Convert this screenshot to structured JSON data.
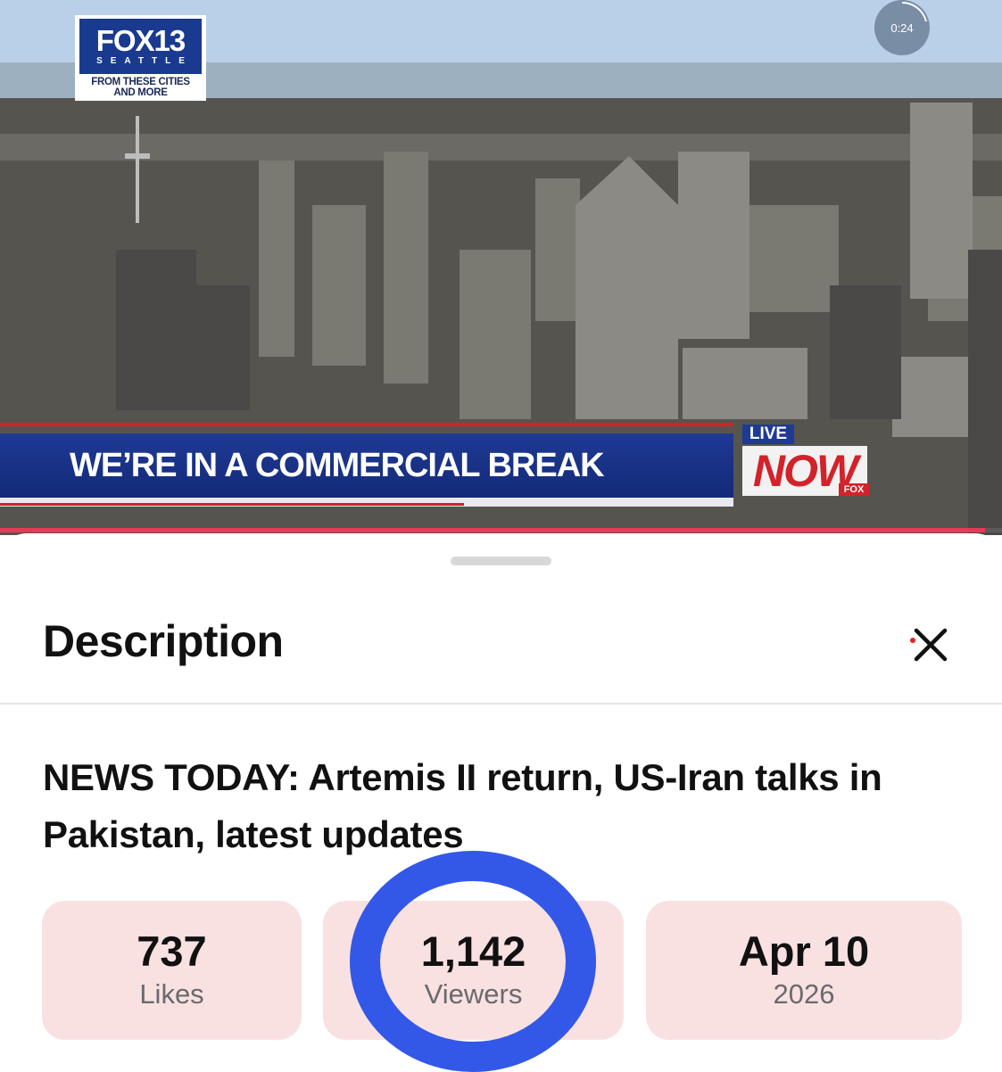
{
  "player": {
    "logo": {
      "brand": "FOX13",
      "city": "SEATTLE",
      "tagline": "FROM THESE CITIES AND MORE"
    },
    "timer": "0:24",
    "banner": {
      "text": "WE’RE IN A COMMERCIAL BREAK"
    },
    "live_badge": {
      "live": "LIVE",
      "now": "NOW",
      "network": "FOX"
    },
    "progress": 0.983,
    "accent_color": "#e83a57"
  },
  "sheet": {
    "title": "Description",
    "close_icon": "close-icon",
    "video_title": "NEWS TODAY: Artemis II return, US-Iran talks in Pakistan, latest updates",
    "stats": [
      {
        "value": "737",
        "label": "Likes"
      },
      {
        "value": "1,142",
        "label": "Viewers"
      },
      {
        "value": "Apr 10",
        "label": "2026"
      }
    ],
    "card_color": "#f9e1e2",
    "highlight_color": "#3358e8"
  }
}
